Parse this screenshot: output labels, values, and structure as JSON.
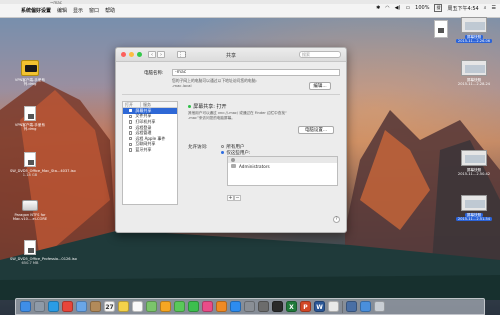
{
  "window_caption": "~mac",
  "menubar": {
    "items": [
      "系统偏好设置",
      "编辑",
      "显示",
      "窗口",
      "帮助"
    ],
    "battery": "100%",
    "input": "搜",
    "clock": "周五下午4:54"
  },
  "desktop_icons": [
    {
      "label": "VPN客户端-手册系列.dmg",
      "icon": "dmg-icon"
    },
    {
      "label": "VPN客户端-手册系列.dmg",
      "icon": "document-icon"
    },
    {
      "label": "SW_DVD5_Office_Mac_Sta...4037.iso",
      "size": "1.18 GB",
      "icon": "document-icon"
    },
    {
      "label": "Paragon NTFS for Mac.v10....ei-CORE",
      "icon": "disk-icon"
    },
    {
      "label": "SW_DVD5_Office_Professio...0126.iso",
      "size": "650.7 MB",
      "icon": "document-icon"
    }
  ],
  "right_icons": [
    {
      "label": "屏幕快照",
      "sub": "2015-11...2.26.06",
      "selected": true,
      "icon": "screenshot-icon"
    },
    {
      "label": "屏幕快照",
      "sub": "2015-11...2.28.24",
      "selected": false,
      "icon": "screenshot-icon"
    },
    {
      "label": "屏幕快照",
      "sub": "2015-11...2.50.42",
      "selected": false,
      "icon": "screenshot-icon"
    },
    {
      "label": "屏幕快照",
      "sub": "2015-11...2.51.54",
      "selected": true,
      "icon": "screenshot-icon"
    }
  ],
  "window": {
    "title": "共享",
    "search_placeholder": "搜索",
    "computer_name_label": "电脑名称:",
    "computer_name_value": "-mac",
    "computer_name_note": "您的子网上的电脑可以通过以下地址访问您的电脑:",
    "computer_name_address": "-mac.local",
    "edit_button": "编辑...",
    "list_headers": [
      "打开",
      "服务"
    ],
    "services": [
      {
        "label": "屏幕共享",
        "checked": true,
        "selected": true
      },
      {
        "label": "文件共享",
        "checked": false
      },
      {
        "label": "打印机共享",
        "checked": false
      },
      {
        "label": "远程登录",
        "checked": false
      },
      {
        "label": "远程管理",
        "checked": false
      },
      {
        "label": "远程 Apple 事件",
        "checked": false
      },
      {
        "label": "互联网共享",
        "checked": false
      },
      {
        "label": "蓝牙共享",
        "checked": false
      }
    ],
    "status": "屏幕共享: 打开",
    "status_desc": "其他用户可以通过 vnc://",
    "status_desc_mid": "-mac/ 或通过在 Finder 边栏中查找“",
    "status_desc_mid2": "-mac”来访问您的电脑屏幕。",
    "computer_settings_button": "电脑设置...",
    "allow_label": "允许访问:",
    "all_users": "所有用户",
    "only_users": "仅这些用户:",
    "user_entries": [
      "",
      "Administrators"
    ],
    "add_label": "+",
    "remove_label": "−",
    "help_label": "?"
  },
  "colors": {
    "accent": "#2e68d6",
    "status_green": "#2fbf48",
    "close": "#fc605c",
    "minimize": "#fdbc40",
    "zoom": "#34c84a"
  },
  "dock_items": [
    {
      "name": "finder-icon",
      "color": "#3f8ee8"
    },
    {
      "name": "launchpad-icon",
      "color": "#8e9aa8"
    },
    {
      "name": "safari-icon",
      "color": "#2a9ce6"
    },
    {
      "name": "chrome-icon",
      "color": "#e7463a"
    },
    {
      "name": "mail-icon",
      "color": "#6aa6e8"
    },
    {
      "name": "contacts-icon",
      "color": "#b28a5a"
    },
    {
      "name": "calendar-icon",
      "color": "#f5f5f5",
      "text": "27"
    },
    {
      "name": "notes-icon",
      "color": "#f4d24a"
    },
    {
      "name": "reminders-icon",
      "color": "#fafafa"
    },
    {
      "name": "maps-icon",
      "color": "#7bc46b"
    },
    {
      "name": "photos-icon",
      "color": "#f5a623"
    },
    {
      "name": "messages-icon",
      "color": "#5ac85a"
    },
    {
      "name": "facetime-icon",
      "color": "#3cbf4e"
    },
    {
      "name": "itunes-icon",
      "color": "#ea4c89"
    },
    {
      "name": "ibooks-icon",
      "color": "#f08a24"
    },
    {
      "name": "appstore-icon",
      "color": "#2d8cf0"
    },
    {
      "name": "system-preferences-icon",
      "color": "#8a8f96"
    },
    {
      "name": "app-icon",
      "color": "#6c6c6c"
    },
    {
      "name": "terminal-icon",
      "color": "#2a2a2a"
    },
    {
      "name": "excel-icon",
      "color": "#1f7a3a",
      "text": "X"
    },
    {
      "name": "powerpoint-icon",
      "color": "#d24726",
      "text": "P"
    },
    {
      "name": "word-icon",
      "color": "#2b5797",
      "text": "W"
    },
    {
      "name": "preview-icon",
      "color": "#e8e8e8"
    },
    {
      "name": "app2-icon",
      "color": "#4a6fa5"
    },
    {
      "name": "downloads-icon",
      "color": "#4a8fdc"
    },
    {
      "name": "trash-icon",
      "color": "#c9ced4"
    }
  ]
}
